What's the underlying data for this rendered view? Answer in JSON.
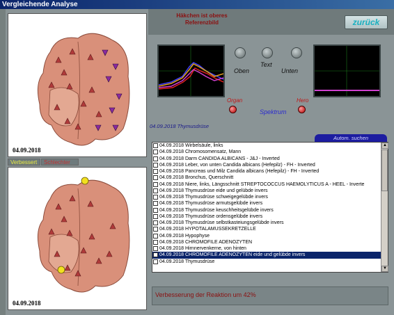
{
  "window": {
    "title": "Vergleichende Analyse"
  },
  "header": {
    "note_line1": "Häkchen ist oberes",
    "note_line2": "Referenzbild",
    "back_label": "zurück"
  },
  "tabs": [
    {
      "label": "Verbessert",
      "color": "#e8e840"
    },
    {
      "label": "Schlechter",
      "color": "#c03030"
    }
  ],
  "images": {
    "top_date": "04.09.2018",
    "bottom_date": "04.09.2018"
  },
  "controls": {
    "knob_labels": [
      "Oben",
      "Text",
      "Unten"
    ],
    "organ_label": "Organ",
    "spectrum_label": "Spektrum",
    "hero_label": "Hero"
  },
  "organ_caption": "04.09.2018 Thymusdrüse",
  "auto_search_label": "Autom. suchen",
  "list": {
    "selected_index": 17,
    "items": [
      "04.09.2018  Wirbelsäule, links",
      "04.09.2018  Chromosomensatz, Mann",
      "04.09.2018  Darm  CANDIDA  ALBICANS  -  J&J - Inverted",
      "04.09.2018  Leber, von unten  Candida albicans (Hefepilz) - FH - Inverted",
      "04.09.2018  Pancreas und Milz  Candida albicans (Hefepilz) - FH - Inverted",
      "04.09.2018  Bronchus, Querschnitt",
      "04.09.2018  Niere, links, Längsschnitt  STREPTOCOCCUS  HAEMOLYTICUS  A   -  HEEL - Inverte",
      "04.09.2018  Thymusdrüse  eide und gelübde invers",
      "04.09.2018  Thymusdrüse  schweigegelübde invers",
      "04.09.2018  Thymusdrüse  armutsgelübde invers",
      "04.09.2018  Thymusdrüse  keuschheitsgelübde invers",
      "04.09.2018  Thymusdrüse  ordensgelübde invers",
      "04.09.2018  Thymusdrüse  selbstkasteiungsgelübde invers",
      "04.09.2018  HYPOTALAMUSSEKRETZELLE",
      "04.09.2018  Hypophyse",
      "04.09.2018  CHROMOFILE ADENOZYTEN",
      "04.09.2018  Hirnnervenkerne, von hinten",
      "04.09.2018  CHROMOFILE ADENOZYTEN  eide und gelübde invers",
      "04.09.2018  Thymusdrüse"
    ]
  },
  "result": {
    "text": "Verbesserung der Reaktion um 42%"
  }
}
